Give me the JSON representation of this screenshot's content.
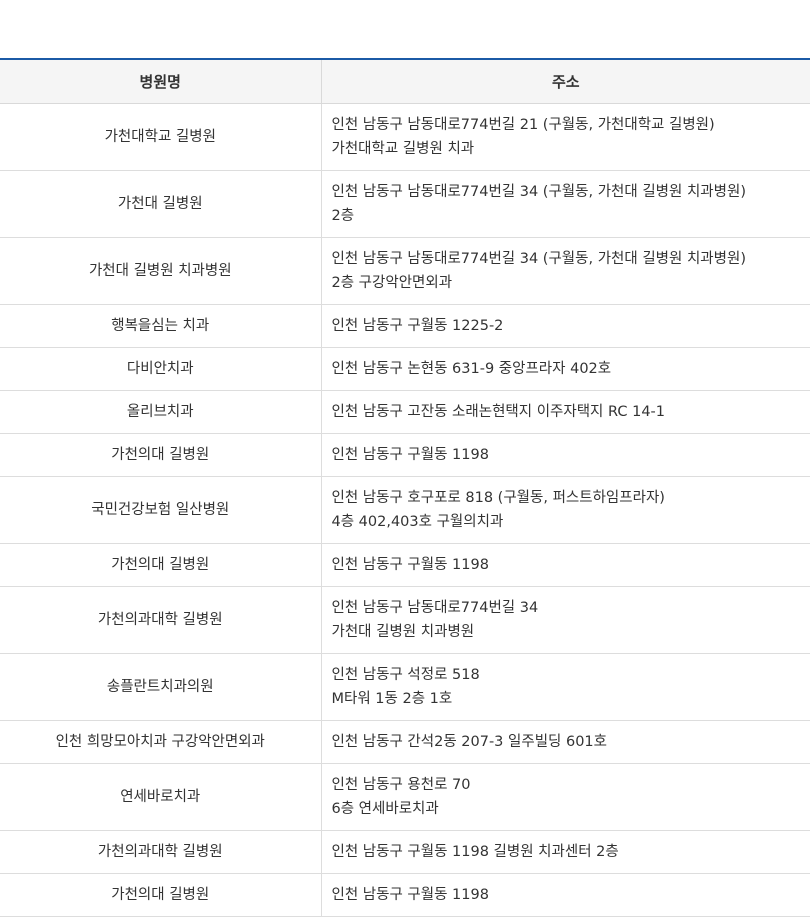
{
  "table": {
    "headers": {
      "name": "병원명",
      "address": "주소"
    },
    "rows": [
      {
        "name": "가천대학교 길병원",
        "address": "인천 남동구 남동대로774번길 21 (구월동, 가천대학교 길병원)\n가천대학교 길병원 치과"
      },
      {
        "name": "가천대 길병원",
        "address": "인천 남동구 남동대로774번길 34 (구월동, 가천대 길병원 치과병원)\n2층"
      },
      {
        "name": "가천대 길병원 치과병원",
        "address": "인천 남동구 남동대로774번길 34 (구월동, 가천대 길병원 치과병원)\n2층 구강악안면외과"
      },
      {
        "name": "행복을심는 치과",
        "address": "인천 남동구 구월동 1225-2"
      },
      {
        "name": "다비안치과",
        "address": "인천 남동구 논현동 631-9 중앙프라자 402호"
      },
      {
        "name": "올리브치과",
        "address": "인천 남동구 고잔동 소래논현택지 이주자택지 RC 14-1"
      },
      {
        "name": "가천의대 길병원",
        "address": "인천 남동구 구월동 1198"
      },
      {
        "name": "국민건강보험 일산병원",
        "address": "인천 남동구 호구포로 818 (구월동, 퍼스트하임프라자)\n4층 402,403호 구월의치과"
      },
      {
        "name": "가천의대 길병원",
        "address": "인천 남동구 구월동 1198"
      },
      {
        "name": "가천의과대학 길병원",
        "address": "인천 남동구 남동대로774번길 34\n가천대 길병원 치과병원"
      },
      {
        "name": "송플란트치과의원",
        "address": "인천 남동구 석정로 518\nM타워 1동 2층 1호"
      },
      {
        "name": "인천 희망모아치과 구강악안면외과",
        "address": "인천 남동구 간석2동 207-3 일주빌딩 601호"
      },
      {
        "name": "연세바로치과",
        "address": "인천 남동구 용천로 70\n6층 연세바로치과"
      },
      {
        "name": "가천의과대학 길병원",
        "address": "인천 남동구 구월동 1198 길병원 치과센터 2층"
      },
      {
        "name": "가천의대 길병원",
        "address": "인천 남동구 구월동 1198"
      }
    ]
  }
}
